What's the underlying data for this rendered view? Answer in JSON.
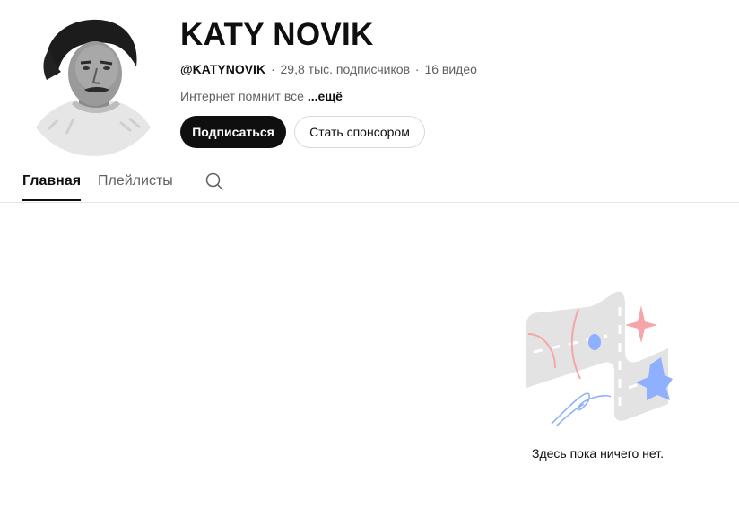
{
  "channel": {
    "name": "KATY NOVIK",
    "handle": "@KATYNOVIK",
    "separator": "·",
    "subscribers": "29,8 тыс. подписчиков",
    "videos": "16 видео",
    "description": "Интернет помнит все",
    "more_label": "...ещё"
  },
  "actions": {
    "subscribe_label": "Подписаться",
    "sponsor_label": "Стать спонсором"
  },
  "tabs": [
    {
      "label": "Главная",
      "active": true
    },
    {
      "label": "Плейлисты",
      "active": false
    }
  ],
  "icons": {
    "tab_search": "search-icon",
    "avatar": "avatar-portrait"
  },
  "empty_state": {
    "message": "Здесь пока ничего нет."
  },
  "colors": {
    "primary_button_bg": "#0f0f0f",
    "text_secondary": "#606060",
    "divider": "#e5e5e5",
    "illustration_pink": "#f6a5a8",
    "illustration_blue": "#8fb0ff"
  }
}
